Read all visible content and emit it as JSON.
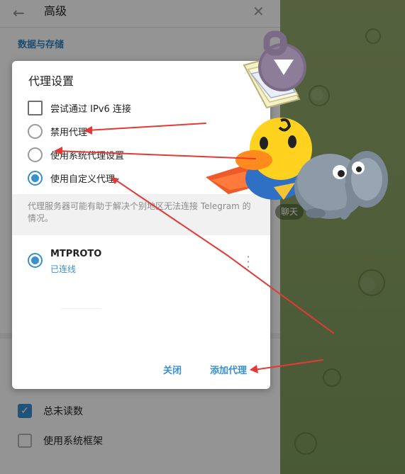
{
  "background": {
    "header_title": "高级",
    "section_title": "数据与存储",
    "checkbox_unread": {
      "label": "总未读数",
      "checked": true
    },
    "checkbox_system_frame": {
      "label": "使用系统框架",
      "checked": false
    },
    "chat_badge": "聊天"
  },
  "dialog": {
    "title": "代理设置",
    "options": [
      {
        "type": "checkbox",
        "label": "尝试通过 IPv6 连接",
        "checked": false
      },
      {
        "type": "radio",
        "label": "禁用代理",
        "selected": false
      },
      {
        "type": "radio",
        "label": "使用系统代理设置",
        "selected": false
      },
      {
        "type": "radio",
        "label": "使用自定义代理",
        "selected": true
      }
    ],
    "info": "代理服务器可能有助于解决个别地区无法连接 Telegram 的情况。",
    "proxy": {
      "name": "MTPROTO",
      "status": "已连线",
      "selected": true
    },
    "buttons": {
      "close": "关闭",
      "add": "添加代理"
    }
  },
  "colors": {
    "accent": "#3a8fd0",
    "annotation": "#e53935",
    "chat_background": "#8aa264"
  },
  "icons": {
    "back": "back-arrow-icon",
    "close": "close-icon",
    "menu": "more-vertical-icon"
  }
}
